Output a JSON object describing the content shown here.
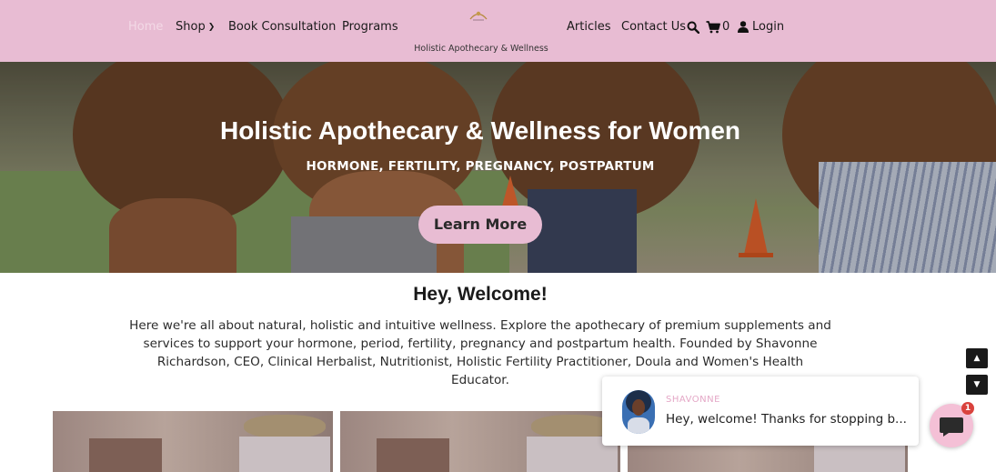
{
  "nav": {
    "home": "Home",
    "shop": "Shop",
    "book": "Book Consultation",
    "programs": "Programs",
    "brand": "Holistic Apothecary & Wellness",
    "articles": "Articles",
    "contact": "Contact Us",
    "cart_count": "0",
    "login": "Login"
  },
  "hero": {
    "title": "Holistic Apothecary & Wellness for Women",
    "subtitle": "HORMONE, FERTILITY, PREGNANCY, POSTPARTUM",
    "button": "Learn More"
  },
  "welcome": {
    "title": "Hey, Welcome!",
    "text": "Here we're all about natural, holistic and intuitive wellness. Explore the apothecary of premium supplements and services to support your hormone, period, fertility, pregnancy and postpartum health. Founded by Shavonne Richardson, CEO, Clinical Herbalist, Nutritionist, Holistic Fertility Practitioner, Doula and Women's Health Educator."
  },
  "chat": {
    "name": "SHAVONNE",
    "message": "Hey, welcome! Thanks for stopping b...",
    "badge": "1"
  },
  "icons": {
    "search": "search-icon",
    "cart": "cart-icon",
    "user": "user-icon",
    "scroll_up": "arrow-up-icon",
    "scroll_down": "arrow-down-icon",
    "chat": "chat-bubble-icon"
  },
  "colors": {
    "nav_bg": "#e8bcd3",
    "accent_pink": "#e8bcd3",
    "chat_name": "#e4a7c6",
    "badge": "#d9423d"
  }
}
